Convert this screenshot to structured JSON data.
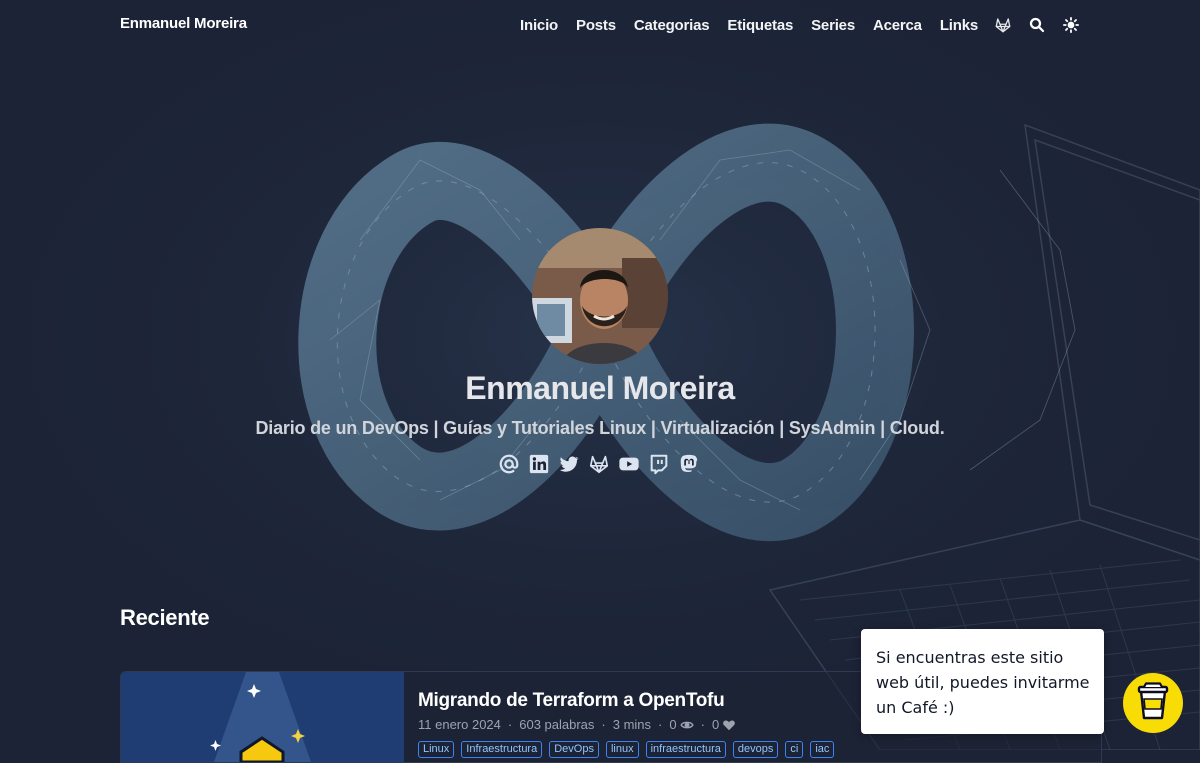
{
  "colors": {
    "background": "#1c2336",
    "text": "#e5e7eb",
    "tag_border": "#3b82f6",
    "coffee_button": "#f7dc06"
  },
  "navbar": {
    "brand": "Enmanuel Moreira",
    "links": [
      "Inicio",
      "Posts",
      "Categorias",
      "Etiquetas",
      "Series",
      "Acerca",
      "Links"
    ],
    "icons": [
      "gitlab-icon",
      "search-icon",
      "theme-toggle-icon"
    ]
  },
  "hero": {
    "name": "Enmanuel Moreira",
    "subtitle": "Diario de un DevOps | Guías y Tutoriales Linux | Virtualización | SysAdmin | Cloud.",
    "social_icons": [
      "email-icon",
      "linkedin-icon",
      "twitter-icon",
      "gitlab-icon",
      "youtube-icon",
      "twitch-icon",
      "mastodon-icon"
    ]
  },
  "recent": {
    "title": "Reciente",
    "posts": [
      {
        "title": "Migrando de Terraform a OpenTofu",
        "date": "11 enero 2024",
        "words": "603 palabras",
        "read_time": "3 mins",
        "views": "0",
        "likes": "0",
        "tags": [
          "Linux",
          "Infraestructura",
          "DevOps",
          "linux",
          "infraestructura",
          "devops",
          "ci",
          "iac"
        ]
      }
    ]
  },
  "coffee": {
    "text": "Si encuentras este sitio web útil, puedes invitarme un Café :)",
    "icon": "coffee-cup-icon"
  }
}
